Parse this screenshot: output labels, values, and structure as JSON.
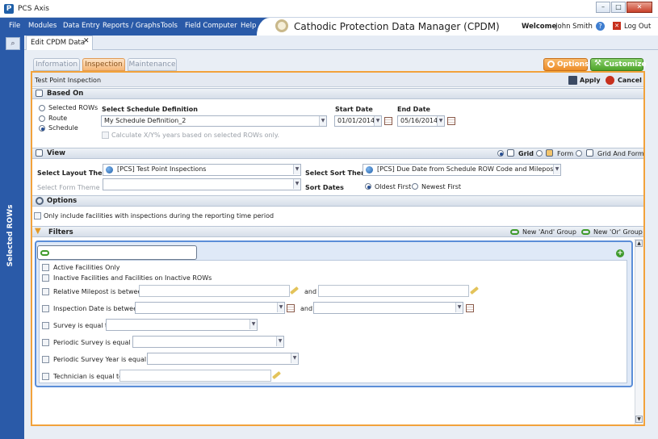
{
  "window": {
    "title": "PCS Axis",
    "app_icon_letter": "P",
    "min": "–",
    "max": "□",
    "close": "✕"
  },
  "menu": [
    "File",
    "Modules",
    "Data Entry",
    "Reports / Graphs",
    "Tools",
    "Field Computer",
    "Help"
  ],
  "header": {
    "app_title": "Cathodic Protection Data Manager (CPDM)",
    "welcome": "Welcome",
    "user": "John Smith",
    "logout": "Log Out"
  },
  "sidebar": {
    "label": "Selected ROWs"
  },
  "doc_tab": {
    "label": "Edit CPDM Data",
    "close": "✕"
  },
  "subtabs": [
    "Information",
    "Inspection",
    "Maintenance"
  ],
  "buttons": {
    "options": "Options",
    "customize": "Customize",
    "apply": "Apply",
    "cancel": "Cancel"
  },
  "panel_title": "Test Point Inspection",
  "based_on": {
    "title": "Based On",
    "radios": [
      "Selected ROWs",
      "Route",
      "Schedule"
    ],
    "selected": "Schedule",
    "schedule_def_label": "Select Schedule Definition",
    "schedule_def_value": "My Schedule Definition_2",
    "start_label": "Start Date",
    "start_value": "01/01/2014",
    "end_label": "End Date",
    "end_value": "05/16/2014",
    "calc_label": "Calculate X/Y% years based on selected ROWs only."
  },
  "view": {
    "title": "View",
    "modes": [
      "Grid",
      "Form",
      "Grid And Form"
    ],
    "selected_mode": "Grid",
    "layout_label": "Select Layout Theme",
    "layout_value": "[PCS] Test Point Inspections",
    "form_label": "Select Form Theme",
    "form_value": "",
    "sort_theme_label": "Select Sort Theme",
    "sort_theme_value": "[PCS] Due Date from Schedule ROW Code and Milepost",
    "sort_dates_label": "Sort Dates",
    "sort_opts": [
      "Oldest First",
      "Newest First"
    ],
    "sort_selected": "Oldest First"
  },
  "options": {
    "title": "Options",
    "checkbox_label": "Only include facilities with inspections during the reporting time period"
  },
  "filters": {
    "title": "Filters",
    "new_and": "New 'And' Group",
    "new_or": "New 'Or' Group",
    "items": [
      "Active Facilities Only",
      "Inactive Facilities and Facilities on Inactive ROWs",
      "Relative Milepost is between",
      "Inspection Date is between",
      "Survey is equal to",
      "Periodic Survey is equal to",
      "Periodic Survey Year is equal to",
      "Technician is equal to"
    ],
    "and_label": "and"
  },
  "colors": {
    "menubar": "#2a5aa8",
    "accent_orange": "#f2a23b",
    "accent_green": "#4ea32b",
    "filter_border": "#5b8ed8"
  }
}
